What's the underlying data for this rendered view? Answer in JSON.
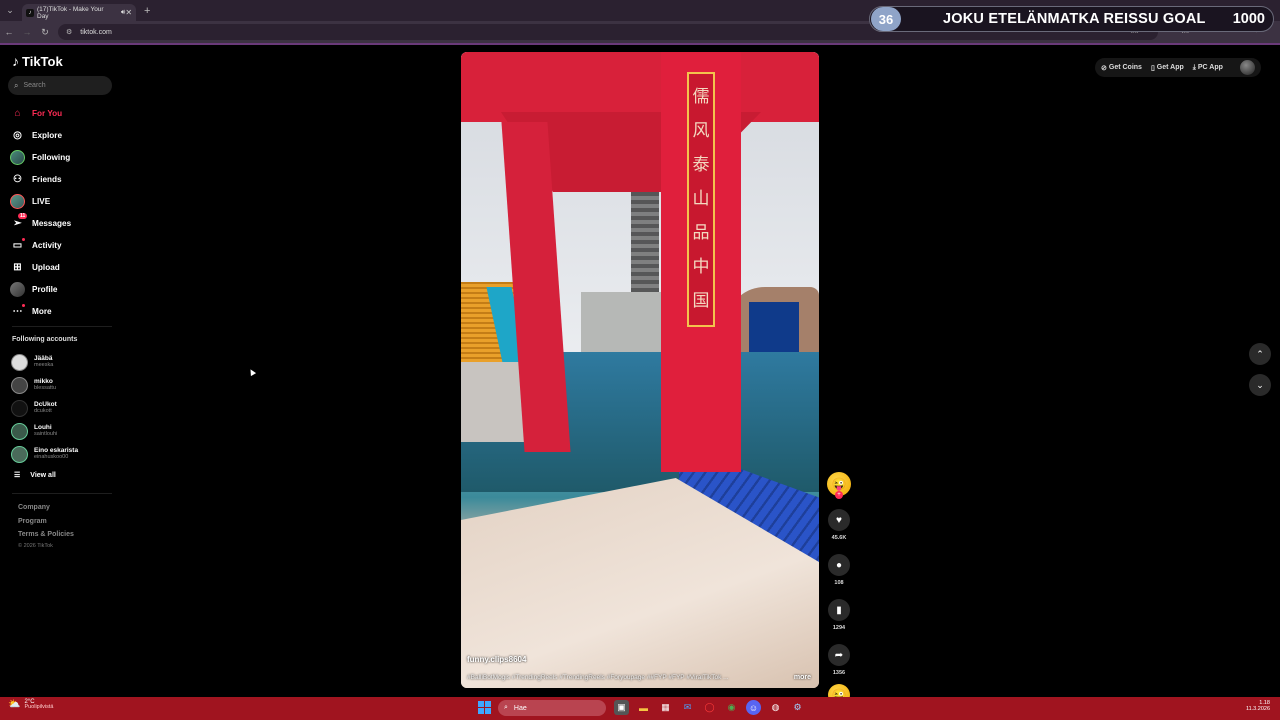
{
  "browser": {
    "tab_title": "(17)TikTok - Make Your Day",
    "url": "tiktok.com"
  },
  "overlay": {
    "badge": "36",
    "goal_text": "JOKU ETELÄNMATKA REISSU GOAL",
    "goal_value": "1000"
  },
  "sidebar": {
    "logo": "TikTok",
    "search_placeholder": "Search",
    "nav": [
      {
        "label": "For You"
      },
      {
        "label": "Explore"
      },
      {
        "label": "Following"
      },
      {
        "label": "Friends"
      },
      {
        "label": "LIVE"
      },
      {
        "label": "Messages",
        "badge": "11"
      },
      {
        "label": "Activity"
      },
      {
        "label": "Upload"
      },
      {
        "label": "Profile"
      },
      {
        "label": "More"
      }
    ],
    "following_title": "Following accounts",
    "accounts": [
      {
        "name": "Jääbä",
        "handle": "meeska"
      },
      {
        "name": "mikko",
        "handle": "blessattu"
      },
      {
        "name": "DcUkot",
        "handle": "dcukott"
      },
      {
        "name": "Louhi",
        "handle": "saintlouhi"
      },
      {
        "name": "Eino eskarista",
        "handle": "einahuskoo00"
      }
    ],
    "view_all": "View all",
    "footer": [
      "Company",
      "Program",
      "Terms & Policies"
    ],
    "copyright": "© 2026 TikTok"
  },
  "video": {
    "plaque_chars": [
      "儒",
      "风",
      "泰",
      "山",
      "品",
      "中",
      "国"
    ],
    "author": "funny.clips8604",
    "tags": "#BalliBotMogis #TrendingReels #TrendingReels #Foryoupage ##FYP #FYP #ViralTikTok ...",
    "more": "more"
  },
  "actions": {
    "likes": "45.6K",
    "comments": "108",
    "saves": "1294",
    "shares": "1356"
  },
  "topbar": {
    "coins": "Get Coins",
    "app": "Get App",
    "pc_app": "PC App"
  },
  "taskbar": {
    "temp": "2°C",
    "weather": "Puolipilvistä",
    "search": "Hae",
    "time": "1.18",
    "date": "11.3.2026"
  }
}
